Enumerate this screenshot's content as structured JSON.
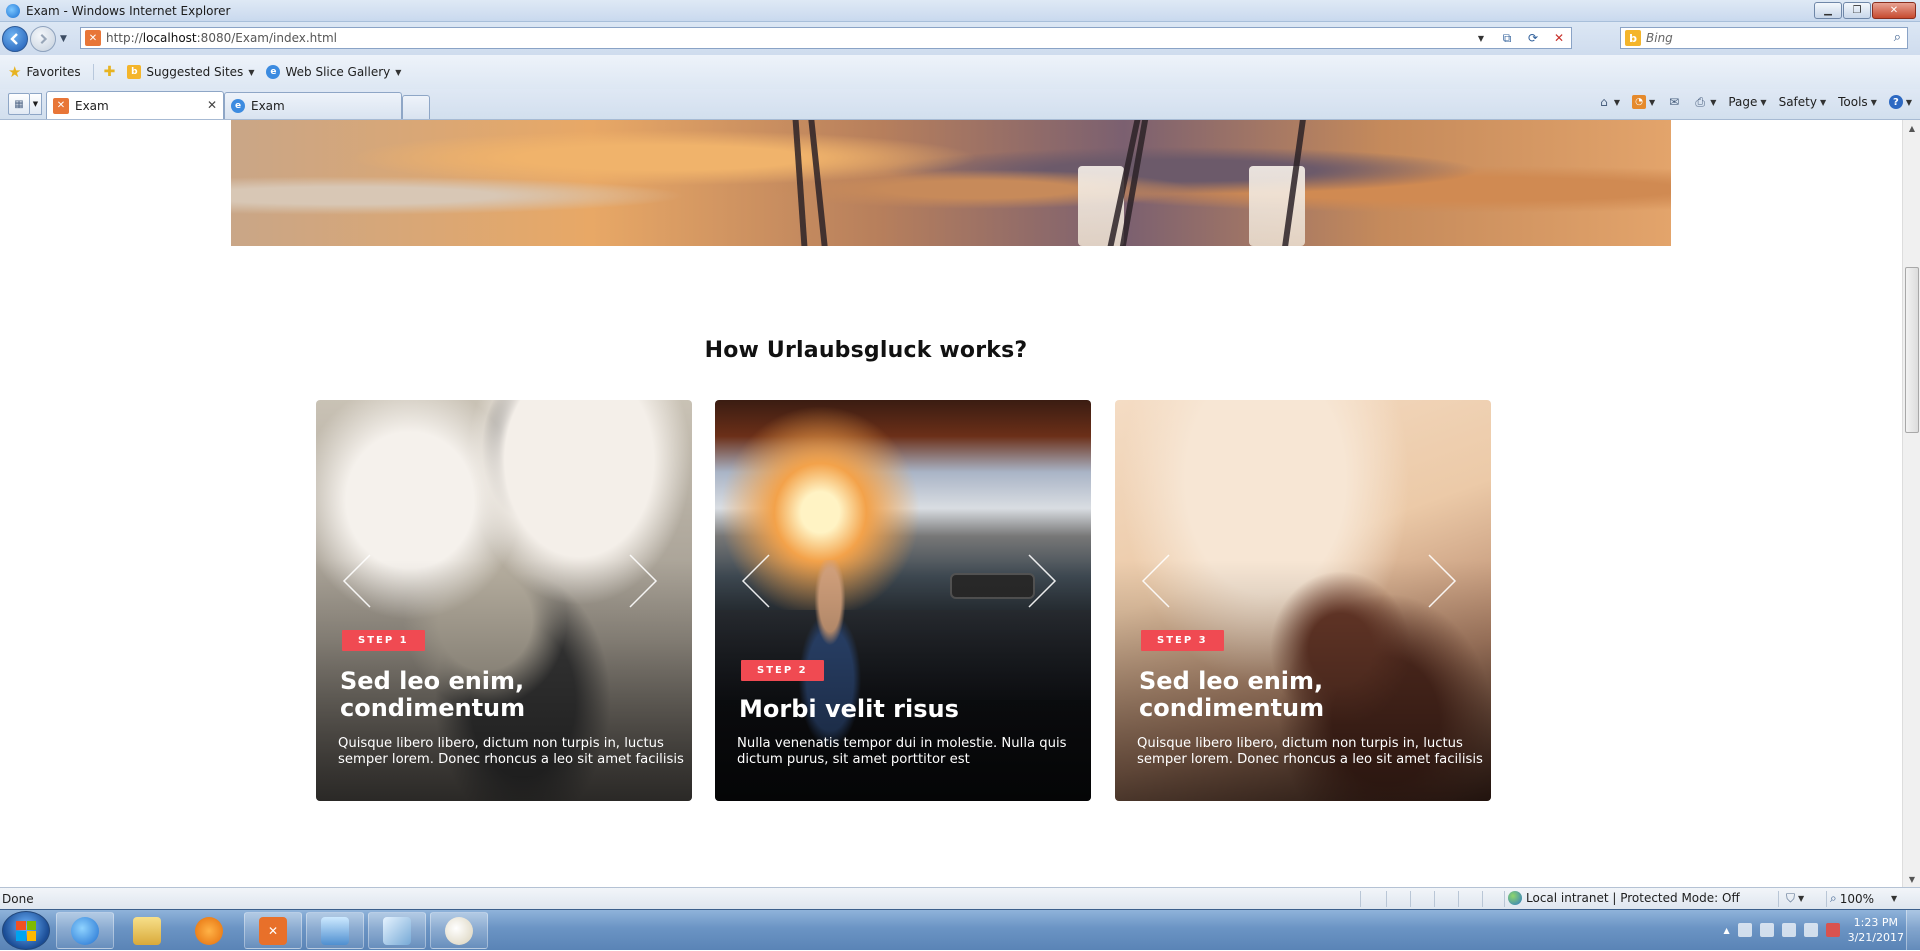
{
  "window": {
    "title": "Exam - Windows Internet Explorer",
    "controls": {
      "minimize": "▁",
      "maximize": "❐",
      "close": "✕"
    }
  },
  "address_bar": {
    "url_prefix": "http://",
    "url_host": "localhost",
    "url_rest": ":8080/Exam/index.html",
    "search_placeholder": "Bing"
  },
  "favorites_bar": {
    "favorites_label": "Favorites",
    "items": [
      {
        "label": "Suggested Sites",
        "icon": "bing-icon"
      },
      {
        "label": "Web Slice Gallery",
        "icon": "ie-icon"
      }
    ]
  },
  "tabs": [
    {
      "label": "Exam",
      "active": true
    },
    {
      "label": "Exam",
      "active": false
    }
  ],
  "command_bar": {
    "page": "Page",
    "safety": "Safety",
    "tools": "Tools"
  },
  "page": {
    "section_title": "How Urlaubsgluck works?",
    "cards": [
      {
        "step": "STEP 1",
        "title": "Sed leo enim, condimentum",
        "text": "Quisque libero libero, dictum non turpis in, luctus semper lorem. Donec rhoncus a leo sit amet facilisis"
      },
      {
        "step": "STEP 2",
        "title": "Morbi velit risus",
        "text": "Nulla venenatis tempor dui in molestie. Nulla quis dictum purus, sit amet porttitor est"
      },
      {
        "step": "STEP 3",
        "title": "Sed leo enim, condimentum",
        "text": "Quisque libero libero, dictum non turpis in, luctus semper lorem. Donec rhoncus a leo sit amet facilisis"
      }
    ],
    "accent_color": "#f04a52"
  },
  "status_bar": {
    "status": "Done",
    "zone": "Local intranet | Protected Mode: Off",
    "zoom": "100%"
  },
  "taskbar": {
    "time": "1:23 PM",
    "date": "3/21/2017"
  }
}
